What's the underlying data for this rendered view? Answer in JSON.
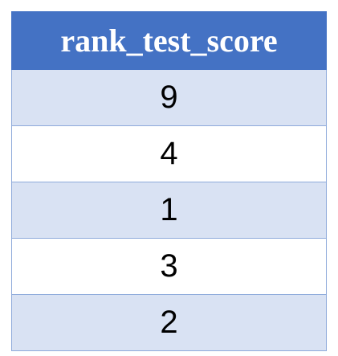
{
  "table": {
    "header": "rank_test_score",
    "rows": [
      "9",
      "4",
      "1",
      "3",
      "2"
    ]
  },
  "colors": {
    "header_bg": "#4472c4",
    "band": "#d9e2f3",
    "border": "#8eaadb"
  }
}
